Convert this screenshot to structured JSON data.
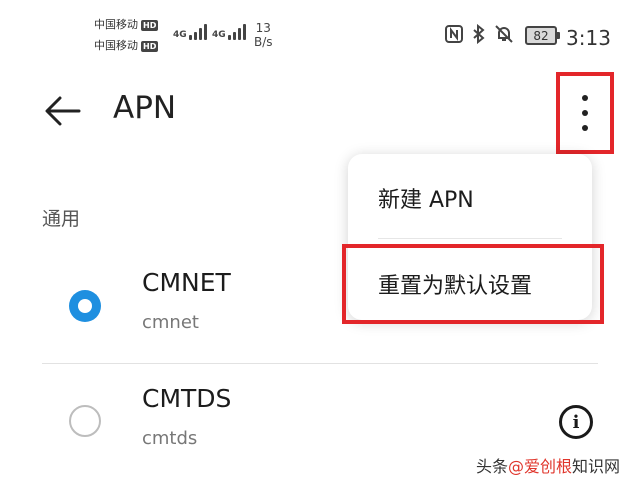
{
  "status_bar": {
    "carriers": [
      {
        "name": "中国移动",
        "badge": "HD",
        "network": "4G"
      },
      {
        "name": "中国移动",
        "badge": "HD",
        "network": "4G"
      }
    ],
    "net_speed_value": "13",
    "net_speed_unit": "B/s",
    "battery": "82",
    "time": "3:13"
  },
  "header": {
    "title": "APN"
  },
  "section_label": "通用",
  "apn_list": [
    {
      "name": "CMNET",
      "sub": "cmnet",
      "selected": true
    },
    {
      "name": "CMTDS",
      "sub": "cmtds",
      "selected": false
    }
  ],
  "menu": {
    "items": [
      {
        "label": "新建 APN"
      },
      {
        "label": "重置为默认设置"
      }
    ]
  },
  "watermark": {
    "part1": "头条",
    "part2": "@爱创根",
    "part3": "知识网"
  },
  "colors": {
    "accent": "#1e8fe0",
    "highlight": "#e3262a"
  }
}
